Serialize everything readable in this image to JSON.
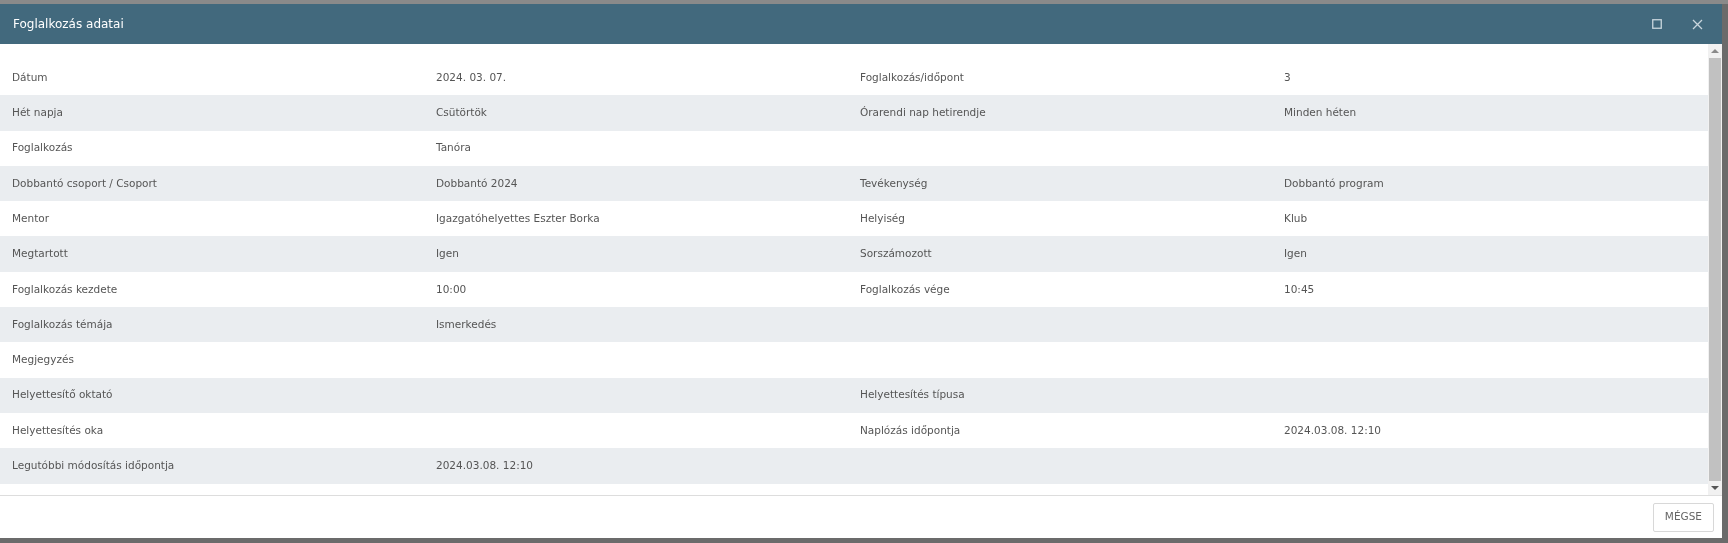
{
  "window": {
    "title": "Foglalkozás adatai"
  },
  "rows": [
    {
      "label": "Dátum",
      "value": "2024. 03. 07.",
      "label_2": "Foglalkozás/időpont",
      "value_2": "3"
    },
    {
      "label": "Hét napja",
      "value": "Csütörtök",
      "label_2": "Órarendi nap hetirendje",
      "value_2": "Minden héten"
    },
    {
      "label": "Foglalkozás",
      "value": "Tanóra"
    },
    {
      "label": "Dobbantó csoport / Csoport",
      "value": "Dobbantó 2024",
      "label_2": "Tevékenység",
      "value_2": "Dobbantó program"
    },
    {
      "label": "Mentor",
      "value": "Igazgatóhelyettes Eszter Borka",
      "label_2": "Helyiség",
      "value_2": "Klub"
    },
    {
      "label": "Megtartott",
      "value": "Igen",
      "label_2": "Sorszámozott",
      "value_2": "Igen"
    },
    {
      "label": "Foglalkozás kezdete",
      "value": "10:00",
      "label_2": "Foglalkozás vége",
      "value_2": "10:45"
    },
    {
      "label": "Foglalkozás témája",
      "value": "Ismerkedés"
    },
    {
      "label": "Megjegyzés"
    },
    {
      "label": "Helyettesítő oktató",
      "label_2": "Helyettesítés típusa"
    },
    {
      "label": "Helyettesítés oka",
      "label_2": "Naplózás időpontja",
      "value_2": "2024.03.08. 12:10"
    },
    {
      "label": "Legutóbbi módosítás időpontja",
      "value": "2024.03.08. 12:10"
    }
  ],
  "buttons": [
    "MÉGSE"
  ]
}
